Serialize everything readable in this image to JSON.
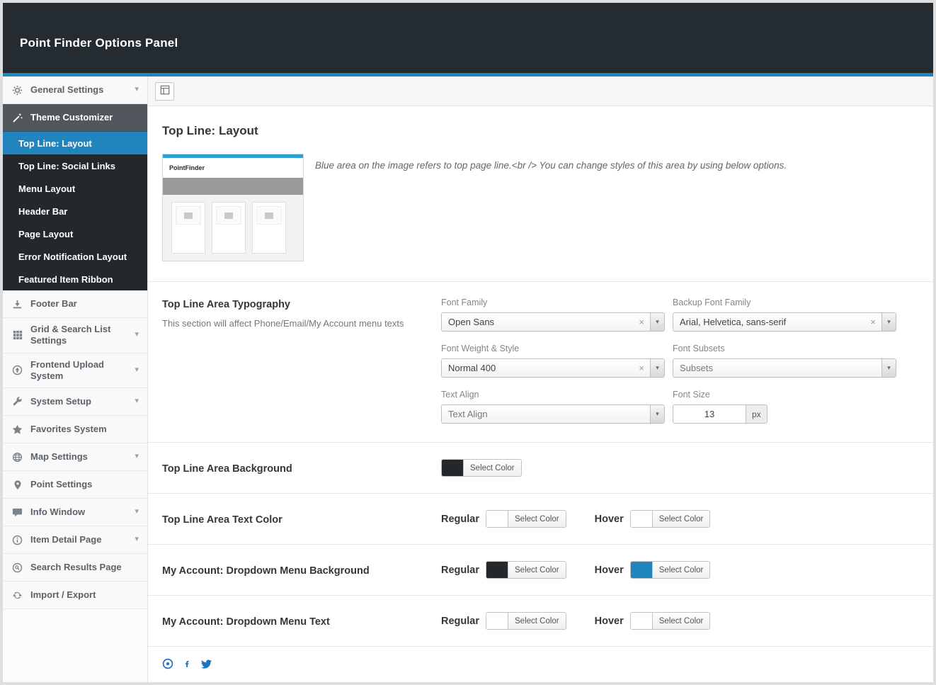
{
  "header": {
    "title": "Point Finder Options Panel"
  },
  "sidebar": {
    "general_settings": "General Settings",
    "theme_customizer": "Theme Customizer",
    "submenu": [
      "Top Line: Layout",
      "Top Line: Social Links",
      "Menu Layout",
      "Header Bar",
      "Page Layout",
      "Error Notification Layout",
      "Featured Item Ribbon"
    ],
    "items": [
      "Footer Bar",
      "Grid & Search List Settings",
      "Frontend Upload System",
      "System Setup",
      "Favorites System",
      "Map Settings",
      "Point Settings",
      "Info Window",
      "Item Detail Page",
      "Search Results Page",
      "Import / Export"
    ]
  },
  "main": {
    "title": "Top Line: Layout",
    "preview_logo": "PointFinder",
    "preview_note": "Blue area on the image refers to top page line.<br /> You can change styles of this area by using below options.",
    "typography": {
      "heading": "Top Line Area Typography",
      "description": "This section will affect Phone/Email/My Account menu texts",
      "font_family": {
        "label": "Font Family",
        "value": "Open Sans"
      },
      "backup_font_family": {
        "label": "Backup Font Family",
        "value": "Arial, Helvetica, sans-serif"
      },
      "font_weight": {
        "label": "Font Weight & Style",
        "value": "Normal 400"
      },
      "font_subsets": {
        "label": "Font Subsets",
        "value": "Subsets"
      },
      "text_align": {
        "label": "Text Align",
        "value": "Text Align"
      },
      "font_size": {
        "label": "Font Size",
        "value": "13",
        "unit": "px"
      }
    },
    "background_row": {
      "label": "Top Line Area Background",
      "color": "#23282d",
      "button_label": "Select Color"
    },
    "text_color_row": {
      "label": "Top Line Area Text Color",
      "regular_label": "Regular",
      "hover_label": "Hover",
      "regular_color": "#ffffff",
      "hover_color": "#ffffff",
      "button_label": "Select Color"
    },
    "account_bg_row": {
      "label": "My Account: Dropdown Menu Background",
      "regular_label": "Regular",
      "hover_label": "Hover",
      "regular_color": "#23282d",
      "hover_color": "#2184bd",
      "button_label": "Select Color"
    },
    "account_text_row": {
      "label": "My Account: Dropdown Menu Text",
      "regular_label": "Regular",
      "hover_label": "Hover",
      "regular_color": "#ffffff",
      "hover_color": "#ffffff",
      "button_label": "Select Color"
    }
  },
  "icons": {
    "chevron_glyph": "▾",
    "caret_glyph": "▾",
    "clear_glyph": "×"
  },
  "colors": {
    "accent_blue": "#2184bd",
    "header_dark": "#242b31",
    "submenu_dark": "#23282d",
    "accent_line": "#1e85be"
  }
}
